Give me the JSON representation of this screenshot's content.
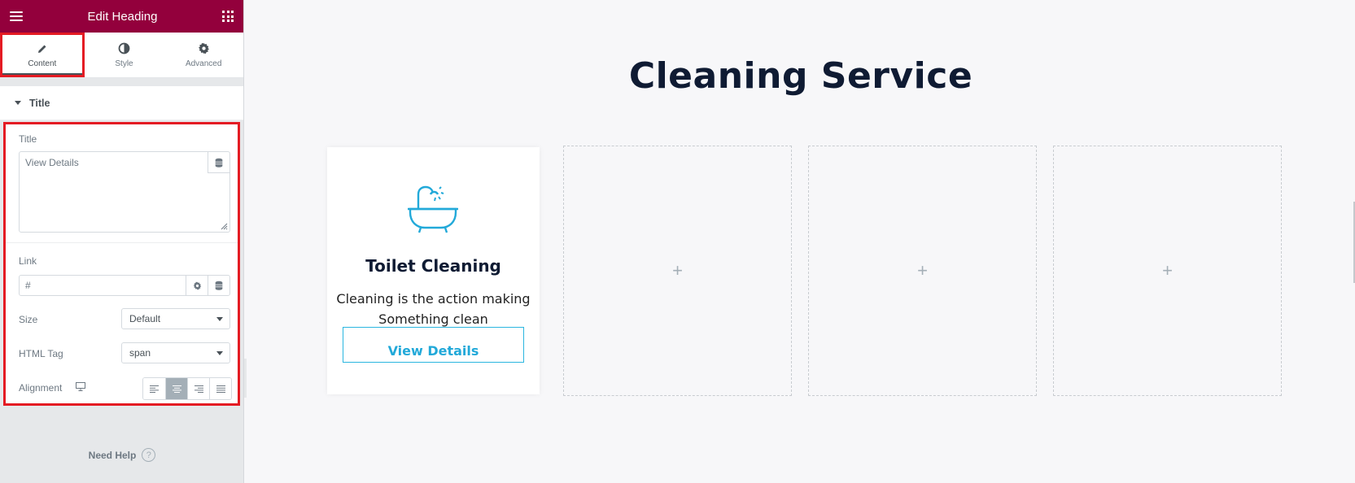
{
  "panel": {
    "title": "Edit Heading",
    "tabs": [
      {
        "label": "Content",
        "icon": "pencil-icon",
        "active": true
      },
      {
        "label": "Style",
        "icon": "half-circle-icon",
        "active": false
      },
      {
        "label": "Advanced",
        "icon": "gear-icon",
        "active": false
      }
    ],
    "section_title": "Title",
    "controls": {
      "title_label": "Title",
      "title_value": "View Details",
      "link_label": "Link",
      "link_value": "#",
      "size_label": "Size",
      "size_value": "Default",
      "html_tag_label": "HTML Tag",
      "html_tag_value": "span",
      "alignment_label": "Alignment",
      "alignment_active": "center"
    },
    "need_help": "Need Help",
    "help_symbol": "?"
  },
  "canvas": {
    "heading": "Cleaning Service",
    "card": {
      "icon": "bathtub-icon",
      "title": "Toilet Cleaning",
      "text": "Cleaning is the action making Something clean",
      "button": "View Details"
    },
    "empty_column_symbol": "+"
  },
  "colors": {
    "panel_header": "#93003c",
    "highlight": "#e41b23",
    "accent_blue": "#22a9d9",
    "heading_dark": "#0f1b33"
  }
}
